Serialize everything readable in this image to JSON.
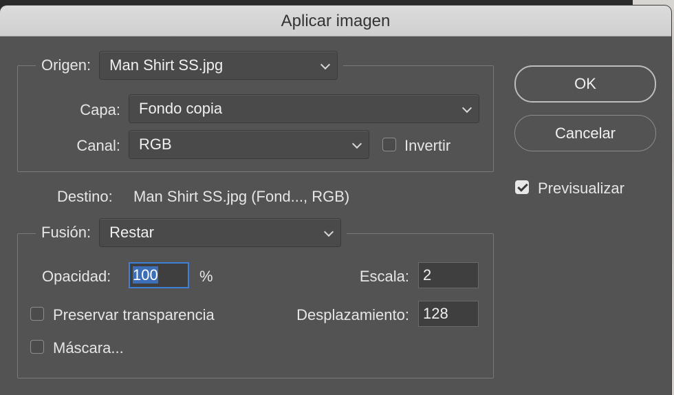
{
  "dialog": {
    "title": "Aplicar imagen"
  },
  "source": {
    "origin_label": "Origen:",
    "origin_value": "Man Shirt SS.jpg",
    "layer_label": "Capa:",
    "layer_value": "Fondo copia",
    "channel_label": "Canal:",
    "channel_value": "RGB",
    "invert_label": "Invertir",
    "invert_checked": false
  },
  "target": {
    "label": "Destino:",
    "value": "Man Shirt SS.jpg (Fond..., RGB)"
  },
  "blending": {
    "blend_label": "Fusión:",
    "blend_value": "Restar",
    "opacity_label": "Opacidad:",
    "opacity_value": "100",
    "opacity_unit": "%",
    "scale_label": "Escala:",
    "scale_value": "2",
    "offset_label": "Desplazamiento:",
    "offset_value": "128",
    "preserve_label": "Preservar transparencia",
    "preserve_checked": false,
    "mask_label": "Máscara...",
    "mask_checked": false
  },
  "buttons": {
    "ok_label": "OK",
    "cancel_label": "Cancelar"
  },
  "preview": {
    "label": "Previsualizar",
    "checked": true
  },
  "icons": {
    "dropdown": "chevron-down-icon",
    "check": "checkmark-icon"
  }
}
